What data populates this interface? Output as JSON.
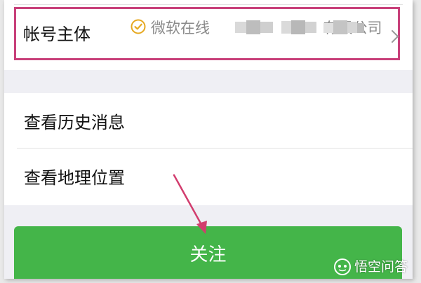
{
  "account": {
    "label": "帐号主体",
    "value_prefix": "微软在线",
    "value_redacted": "██████████",
    "value_suffix": "有限公司"
  },
  "menu": {
    "history_label": "查看历史消息",
    "location_label": "查看地理位置"
  },
  "follow_button": {
    "label": "关注"
  },
  "watermark": {
    "text": "悟空问答"
  },
  "colors": {
    "highlight_border": "#c8407a",
    "follow_green": "#44b549",
    "arrow": "#d23d6e",
    "verify_icon": "#e6a820"
  },
  "icons": {
    "verify": "check-circle-icon",
    "chevron": "chevron-right-icon",
    "watermark": "wukong-logo-icon"
  }
}
